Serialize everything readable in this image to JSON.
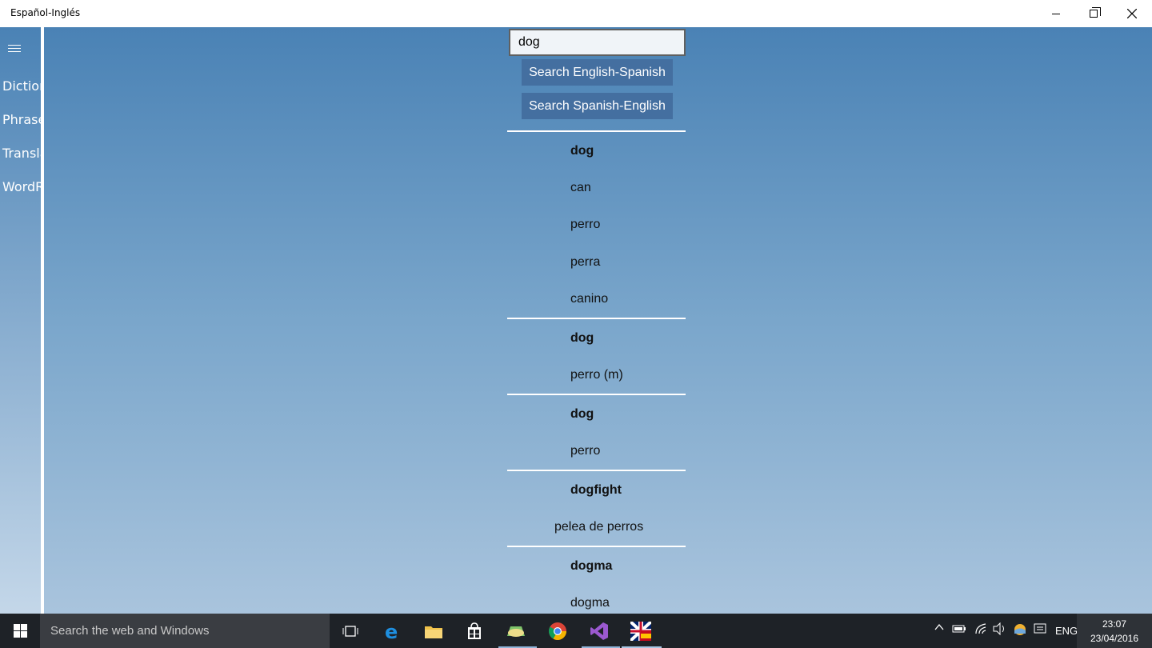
{
  "window": {
    "title": "Español-Inglés"
  },
  "sidebar": {
    "items": [
      {
        "label": "Diction"
      },
      {
        "label": "Phrases"
      },
      {
        "label": "Translat"
      },
      {
        "label": "WordRe"
      }
    ]
  },
  "search": {
    "value": "dog",
    "btn_en_es": "Search English-Spanish",
    "btn_es_en": "Search Spanish-English"
  },
  "results": [
    {
      "term": "dog",
      "translations": [
        "can",
        "perro",
        "perra",
        "canino"
      ]
    },
    {
      "term": "dog",
      "translations": [
        "perro (m)"
      ]
    },
    {
      "term": "dog",
      "translations": [
        "perro"
      ]
    },
    {
      "term": "dogfight",
      "translations": [
        "pelea de perros"
      ]
    },
    {
      "term": "dogma",
      "translations": [
        "dogma"
      ]
    }
  ],
  "taskbar": {
    "search_placeholder": "Search the web and Windows",
    "language": "ENG",
    "time": "23:07",
    "date": "23/04/2016"
  },
  "colors": {
    "accent": "#446fa0",
    "taskbar": "#1e2227"
  }
}
